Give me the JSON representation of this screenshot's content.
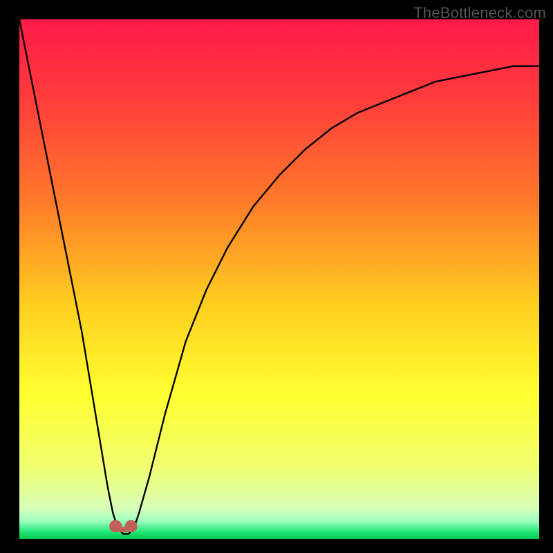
{
  "watermark": "TheBottleneck.com",
  "chart_data": {
    "type": "line",
    "title": "",
    "xlabel": "",
    "ylabel": "",
    "xlim": [
      0,
      100
    ],
    "ylim": [
      0,
      100
    ],
    "series": [
      {
        "name": "bottleneck-curve",
        "x": [
          0,
          3,
          6,
          9,
          12,
          15,
          17,
          18,
          19,
          20,
          21,
          22,
          23,
          25,
          28,
          32,
          36,
          40,
          45,
          50,
          55,
          60,
          65,
          70,
          75,
          80,
          85,
          90,
          95,
          100
        ],
        "y": [
          100,
          85,
          70,
          55,
          40,
          22,
          10,
          5,
          2,
          1,
          1,
          2,
          5,
          12,
          24,
          38,
          48,
          56,
          64,
          70,
          75,
          79,
          82,
          84,
          86,
          88,
          89,
          90,
          91,
          91
        ]
      }
    ],
    "markers": [
      {
        "name": "valley-left",
        "x": 18.5,
        "y": 2.5,
        "color": "#c06058",
        "size": 9
      },
      {
        "name": "valley-right",
        "x": 21.5,
        "y": 2.5,
        "color": "#c06058",
        "size": 9
      }
    ],
    "gradient_stops": [
      {
        "offset": 0.0,
        "color": "#ff1a4a"
      },
      {
        "offset": 0.15,
        "color": "#ff3b3b"
      },
      {
        "offset": 0.35,
        "color": "#ff7a2a"
      },
      {
        "offset": 0.55,
        "color": "#ffcf20"
      },
      {
        "offset": 0.72,
        "color": "#ffff30"
      },
      {
        "offset": 0.86,
        "color": "#f1ff70"
      },
      {
        "offset": 0.94,
        "color": "#d8ffb8"
      },
      {
        "offset": 0.965,
        "color": "#9effc0"
      },
      {
        "offset": 0.985,
        "color": "#26e87a"
      },
      {
        "offset": 1.0,
        "color": "#00c94d"
      }
    ]
  }
}
